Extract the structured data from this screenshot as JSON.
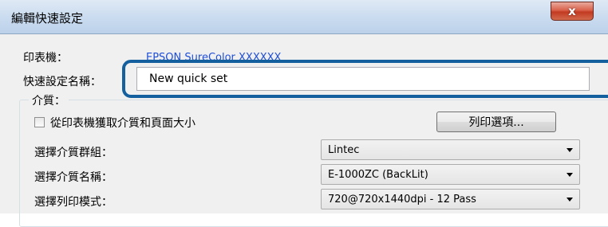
{
  "window": {
    "title": "編輯快速設定",
    "close_label": "x"
  },
  "form": {
    "printer_label": "印表機：",
    "printer_value": "EPSON SureColor XXXXXX",
    "name_label": "快速設定名稱：",
    "name_value": "New quick set"
  },
  "media": {
    "group_label": "介質：",
    "checkbox_label": "從印表機獲取介質和頁面大小",
    "checkbox_checked": false,
    "print_options_button": "列印選項...",
    "media_group_label": "選擇介質群組：",
    "media_group_value": "Lintec",
    "media_name_label": "選擇介質名稱：",
    "media_name_value": "E-1000ZC (BackLit)",
    "print_mode_label": "選擇列印模式：",
    "print_mode_value": "720@720x1440dpi - 12 Pass"
  },
  "colors": {
    "highlight": "#14609e",
    "printer_text": "#1f4ed8"
  }
}
